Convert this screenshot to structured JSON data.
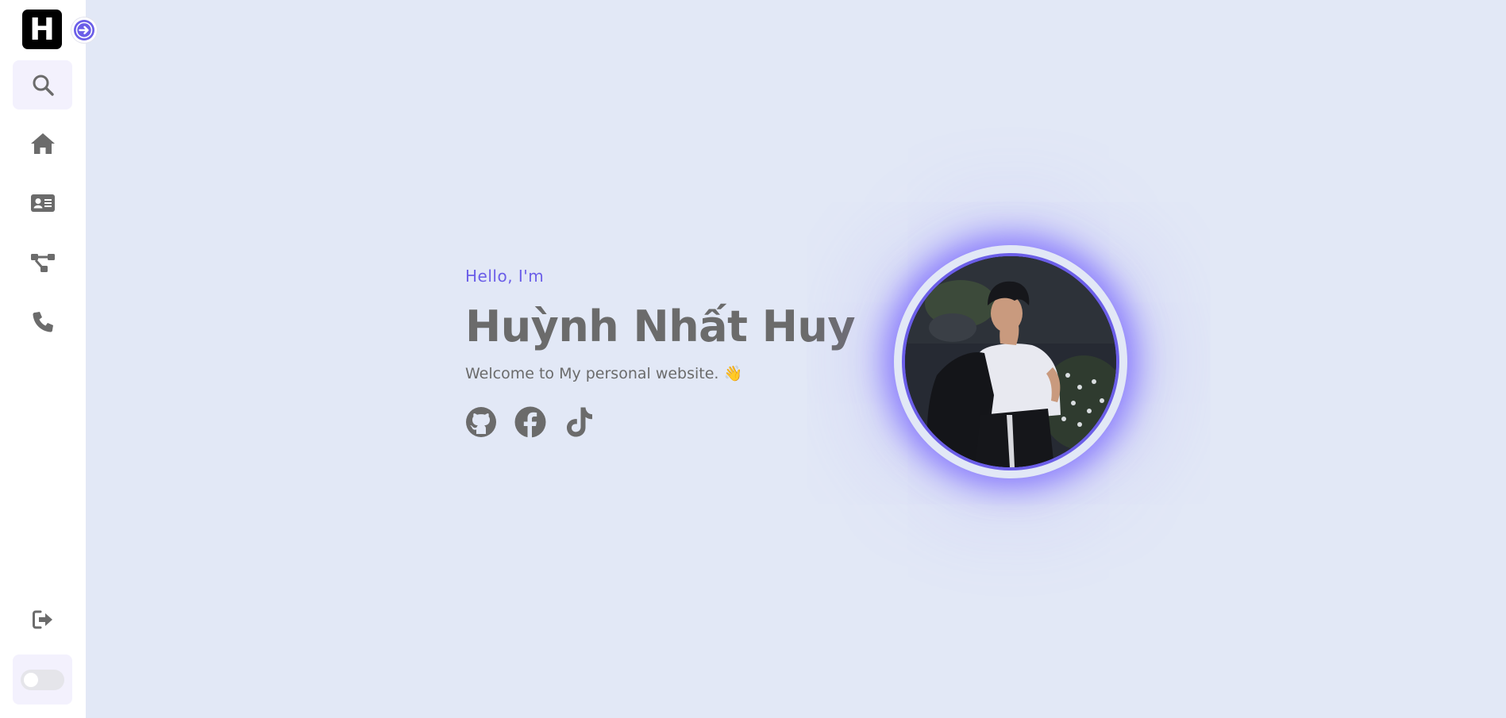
{
  "sidebar": {
    "logo_letter": "H",
    "expand_icon": "arrow-circle-right-icon",
    "items": [
      {
        "icon": "search-icon",
        "active": true
      },
      {
        "icon": "home-icon",
        "active": false
      },
      {
        "icon": "id-card-icon",
        "active": false
      },
      {
        "icon": "sitemap-icon",
        "active": false
      },
      {
        "icon": "phone-icon",
        "active": false
      }
    ],
    "logout_icon": "logout-icon",
    "theme_toggle_on": false
  },
  "hero": {
    "greeting": "Hello, I'm",
    "name": "Huỳnh Nhất Huy",
    "welcome": "Welcome to My personal website. 👋",
    "socials": [
      "github-icon",
      "facebook-icon",
      "tiktok-icon"
    ]
  },
  "colors": {
    "accent": "#6b5ee8",
    "background": "#e2e8f6",
    "text": "#6b6b6b",
    "sidebar": "#ffffff"
  }
}
